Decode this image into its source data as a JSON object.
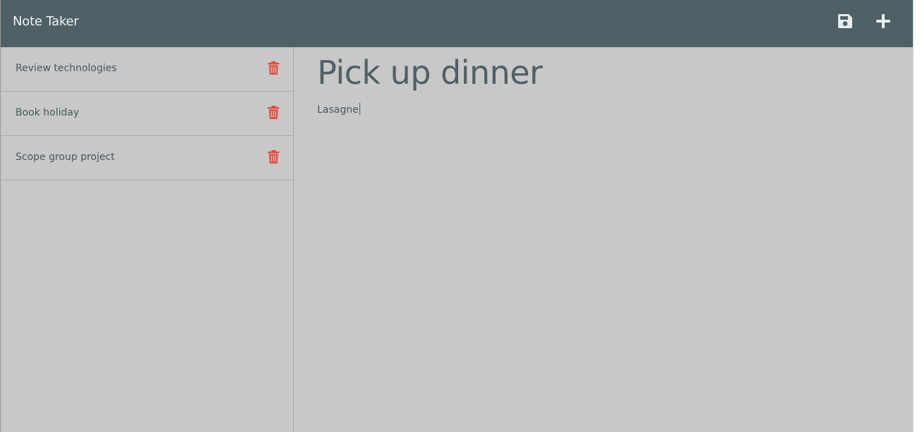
{
  "app": {
    "title": "Note Taker"
  },
  "toolbar": {
    "save_icon": "floppy-disk-icon",
    "new_icon": "plus-icon"
  },
  "sidebar": {
    "items": [
      {
        "label": "Review technologies",
        "icon": "trash-icon"
      },
      {
        "label": "Book holiday",
        "icon": "trash-icon"
      },
      {
        "label": "Scope group project",
        "icon": "trash-icon"
      }
    ]
  },
  "editor": {
    "title": "Pick up dinner",
    "body": "Lasagne"
  },
  "colors": {
    "navbar": "#4f6166",
    "background": "#c8c8c8",
    "delete": "#e74c3c",
    "text": "#46575c"
  }
}
